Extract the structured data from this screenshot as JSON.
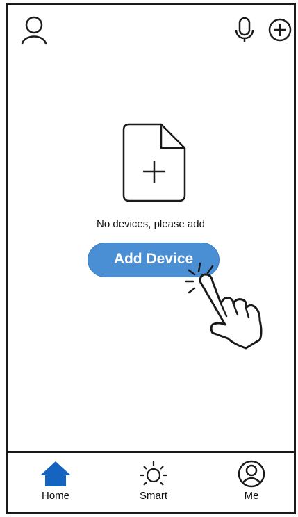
{
  "header": {
    "profile_icon": "user-icon",
    "voice_icon": "microphone-icon",
    "add_icon": "plus-circle-icon"
  },
  "empty_state": {
    "icon": "add-document-icon",
    "message": "No devices, please add",
    "button_label": "Add Device",
    "pointer_icon": "hand-pointer-icon"
  },
  "tabbar": {
    "tabs": [
      {
        "label": "Home",
        "icon": "home-icon",
        "active": true
      },
      {
        "label": "Smart",
        "icon": "sun-icon",
        "active": false
      },
      {
        "label": "Me",
        "icon": "user-circle-icon",
        "active": false
      }
    ]
  },
  "colors": {
    "accent": "#4a8fd4",
    "active_tab": "#1565c0",
    "outline": "#1a1a1a"
  }
}
